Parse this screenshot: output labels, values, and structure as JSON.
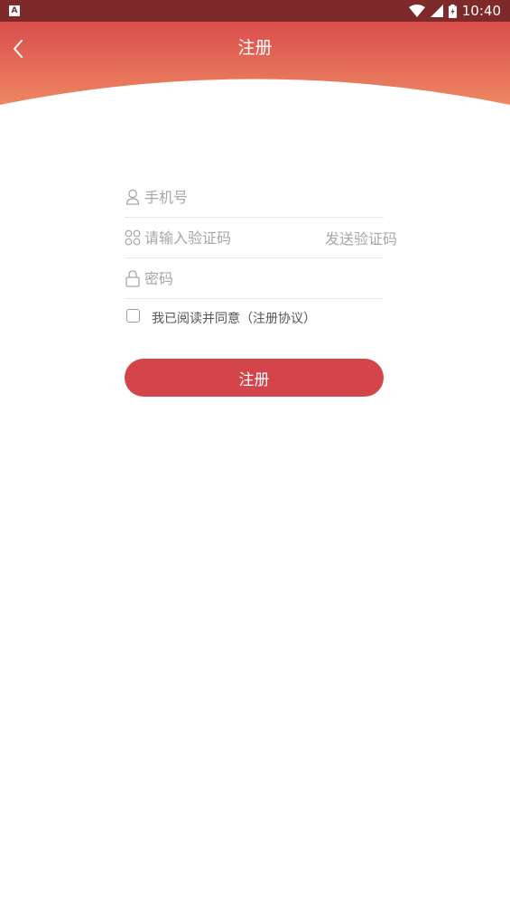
{
  "status_bar": {
    "notification_icon": "A",
    "time": "10:40",
    "icons": [
      "wifi-icon",
      "signal-icon",
      "battery-icon"
    ]
  },
  "header": {
    "title": "注册",
    "back_icon": "chevron-left-icon",
    "gradient_top": "#d94d4c",
    "gradient_bottom": "#ee8762"
  },
  "form": {
    "phone": {
      "placeholder": "手机号",
      "value": "",
      "icon": "user-icon"
    },
    "code": {
      "placeholder": "请输入验证码",
      "value": "",
      "icon": "code-icon",
      "send_label": "发送验证码"
    },
    "password": {
      "placeholder": "密码",
      "value": "",
      "icon": "lock-icon"
    },
    "agreement": {
      "text": "我已阅读并同意",
      "link": "（注册协议）",
      "checked": false
    }
  },
  "submit": {
    "label": "注册",
    "color": "#d4444b"
  }
}
